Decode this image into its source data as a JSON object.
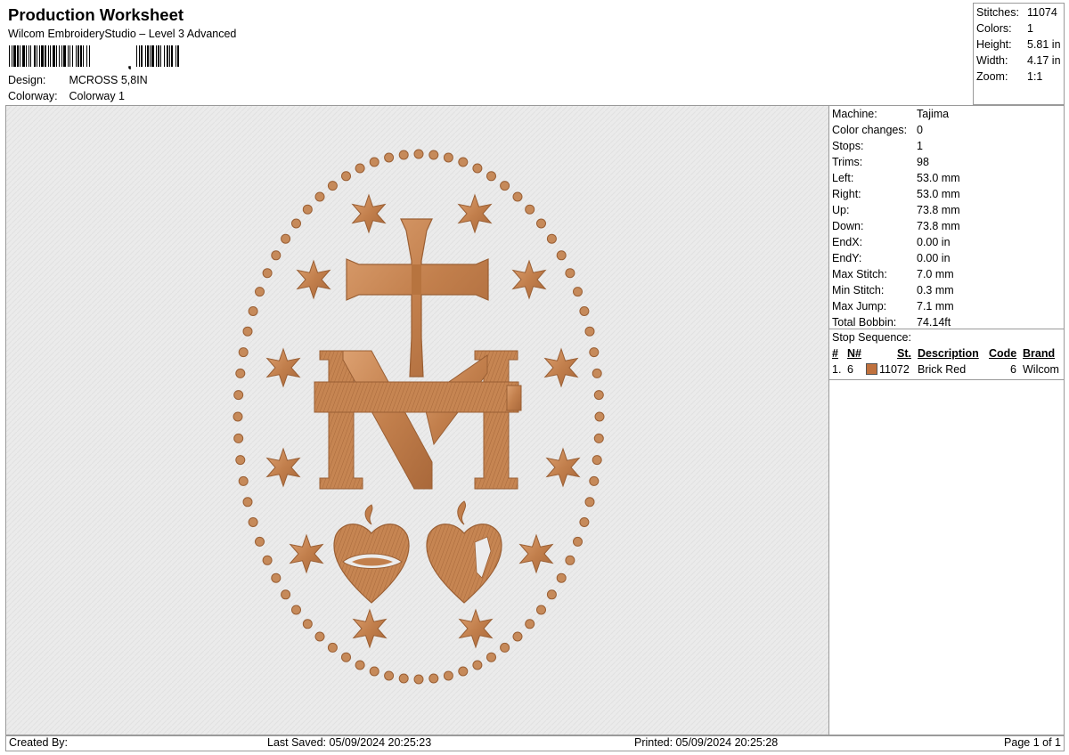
{
  "header": {
    "title": "Production Worksheet",
    "subtitle": "Wilcom EmbroideryStudio – Level 3 Advanced",
    "design_label": "Design:",
    "design_value": "MCROSS 5,8IN",
    "colorway_label": "Colorway:",
    "colorway_value": "Colorway 1"
  },
  "stats": {
    "stitches_label": "Stitches:",
    "stitches_value": "11074",
    "colors_label": "Colors:",
    "colors_value": "1",
    "height_label": "Height:",
    "height_value": "5.81 in",
    "width_label": "Width:",
    "width_value": "4.17 in",
    "zoom_label": "Zoom:",
    "zoom_value": "1:1"
  },
  "machine_info": {
    "rows": [
      {
        "label": "Machine:",
        "value": "Tajima"
      },
      {
        "label": "Color changes:",
        "value": "0"
      },
      {
        "label": "Stops:",
        "value": "1"
      },
      {
        "label": "Trims:",
        "value": "98"
      },
      {
        "label": "Left:",
        "value": "53.0 mm"
      },
      {
        "label": "Right:",
        "value": "53.0 mm"
      },
      {
        "label": "Up:",
        "value": "73.8 mm"
      },
      {
        "label": "Down:",
        "value": "73.8 mm"
      },
      {
        "label": "EndX:",
        "value": "0.00 in"
      },
      {
        "label": "EndY:",
        "value": "0.00 in"
      },
      {
        "label": "Max Stitch:",
        "value": "7.0 mm"
      },
      {
        "label": "Min Stitch:",
        "value": "0.3 mm"
      },
      {
        "label": "Max Jump:",
        "value": "7.1 mm"
      },
      {
        "label": "Total Bobbin:",
        "value": "74.14ft"
      }
    ]
  },
  "stop_sequence": {
    "title": "Stop Sequence:",
    "columns": {
      "num": "#",
      "n": "N#",
      "st": "St.",
      "description": "Description",
      "code": "Code",
      "brand": "Brand"
    },
    "rows": [
      {
        "num": "1.",
        "n": "6",
        "st": "11072",
        "description": "Brick Red",
        "code": "6",
        "brand": "Wilcom",
        "color": "#c0713d"
      }
    ]
  },
  "footer": {
    "created_by": "Created By:",
    "last_saved": "Last Saved: 05/09/2024 20:25:23",
    "printed": "Printed: 05/09/2024 20:25:28",
    "page": "Page 1 of 1"
  },
  "design_colors": {
    "thread": "#c68a5a",
    "thread_dark": "#9a5f34",
    "thread_light": "#e0aa7c"
  }
}
